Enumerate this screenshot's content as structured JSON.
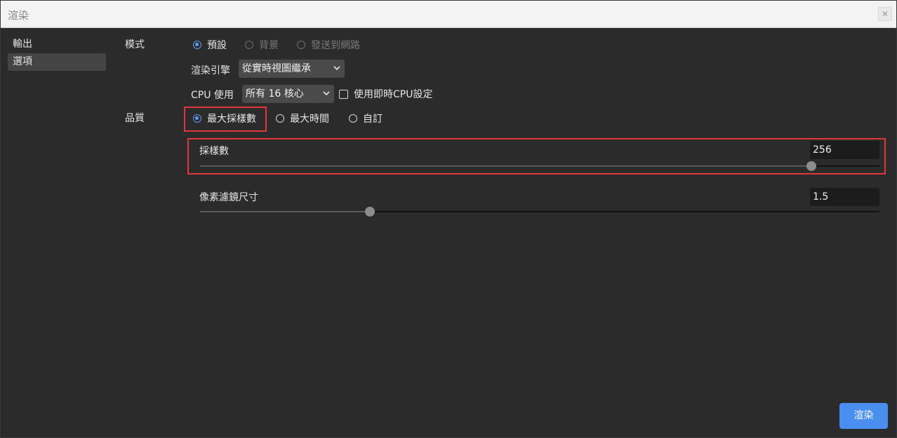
{
  "window": {
    "title": "渲染",
    "close_glyph": "✕"
  },
  "sidebar": {
    "items": [
      {
        "label": "輸出",
        "active": false
      },
      {
        "label": "選項",
        "active": true
      }
    ]
  },
  "mode": {
    "label": "模式",
    "options": [
      {
        "label": "預設",
        "checked": true,
        "disabled": false
      },
      {
        "label": "背景",
        "checked": false,
        "disabled": true
      },
      {
        "label": "發送到網路",
        "checked": false,
        "disabled": true
      }
    ],
    "engine": {
      "label": "渲染引擎",
      "value": "從實時視圖繼承"
    },
    "cpu": {
      "label": "CPU 使用",
      "value": "所有 16 核心"
    },
    "realtime_cpu": {
      "label": "使用即時CPU設定",
      "checked": false
    }
  },
  "quality": {
    "label": "品質",
    "options": [
      {
        "label": "最大採樣數",
        "checked": true
      },
      {
        "label": "最大時間",
        "checked": false
      },
      {
        "label": "自訂",
        "checked": false
      }
    ]
  },
  "sliders": {
    "samples": {
      "label": "採樣數",
      "value": "256",
      "fraction": 0.9
    },
    "pixel_filter": {
      "label": "像素濾鏡尺寸",
      "value": "1.5",
      "fraction": 0.25
    }
  },
  "actions": {
    "render_label": "渲染"
  },
  "colors": {
    "accent": "#4a8fef",
    "highlight": "#e0363c",
    "background": "#2b2b2b"
  }
}
